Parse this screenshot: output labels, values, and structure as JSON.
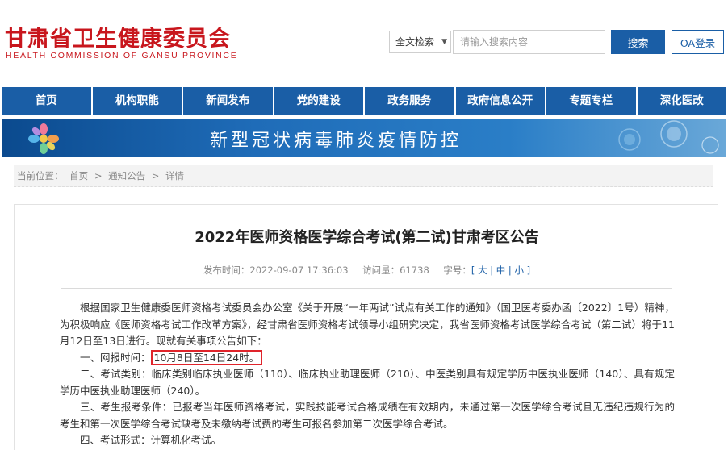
{
  "header": {
    "logo_cn": "甘肃省卫生健康委员会",
    "logo_en": "HEALTH  COMMISSION  OF  GANSU  PROVINCE"
  },
  "search": {
    "scope": "全文检索",
    "placeholder": "请输入搜索内容",
    "button": "搜索",
    "oa_button": "OA登录"
  },
  "nav": {
    "items": [
      {
        "label": "首页"
      },
      {
        "label": "机构职能"
      },
      {
        "label": "新闻发布"
      },
      {
        "label": "党的建设"
      },
      {
        "label": "政务服务"
      },
      {
        "label": "政府信息公开"
      },
      {
        "label": "专题专栏"
      },
      {
        "label": "深化医改"
      }
    ]
  },
  "banner": {
    "text": "新型冠状病毒肺炎疫情防控"
  },
  "breadcrumb": {
    "prefix": "当前位置：",
    "home": "首页",
    "sep1": ">",
    "section": "通知公告",
    "sep2": ">",
    "current": "详情"
  },
  "article": {
    "title": "2022年医师资格医学综合考试(第二试)甘肃考区公告",
    "publish_label": "发布时间：",
    "publish_time": "2022-09-07 17:36:03",
    "visits_label": "访问量：",
    "visits": "61738",
    "size_label": "字号：",
    "size_big": "大",
    "size_mid": "中",
    "size_small": "小",
    "p1": "根据国家卫生健康委医师资格考试委员会办公室《关于开展“一年两试”试点有关工作的通知》（国卫医考委办函〔2022〕1号）精神，为积极响应《医师资格考试工作改革方案》，经甘肃省医师资格考试领导小组研究决定，我省医师资格考试医学综合考试（第二试）将于11月12日至13日进行。现就有关事项公告如下：",
    "p2_label": "一、网报时间：",
    "p2_value": "10月8日至14日24时。",
    "p3": "二、考试类别：临床类别临床执业医师（110）、临床执业助理医师（210）、中医类别具有规定学历中医执业医师（140）、具有规定学历中医执业助理医师（240）。",
    "p4": "三、考生报考条件：已报考当年医师资格考试，实践技能考试合格成绩在有效期内，未通过第一次医学综合考试且无违纪违规行为的考生和第一次医学综合考试缺考及未缴纳考试费的考生可报名参加第二次医学综合考试。",
    "p5": "四、考试形式：计算机化考试。"
  },
  "colors": {
    "brand_red": "#c8161d",
    "nav_blue": "#1a5ea6",
    "highlight_red": "#e0242b"
  }
}
